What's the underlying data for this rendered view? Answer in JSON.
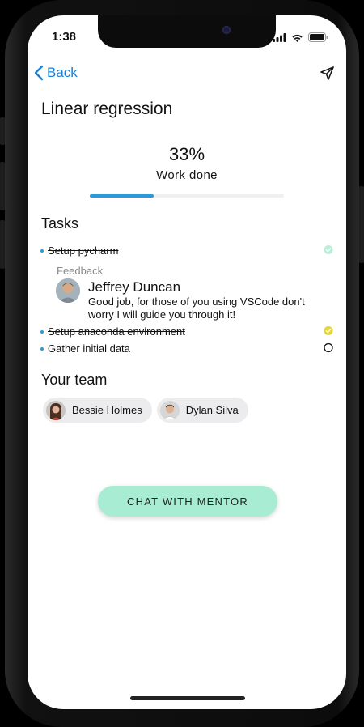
{
  "status_bar": {
    "time": "1:38"
  },
  "nav": {
    "back_label": "Back"
  },
  "page": {
    "title": "Linear regression"
  },
  "progress": {
    "percent_label": "33%",
    "label": "Work done",
    "fraction": 0.33
  },
  "tasks": {
    "heading": "Tasks",
    "items": [
      {
        "label": "Setup pycharm",
        "done": true,
        "status_color": "#b9eed8"
      },
      {
        "label": "Setup anaconda environment",
        "done": true,
        "status_color": "#e6d631"
      },
      {
        "label": "Gather initial data",
        "done": false,
        "status_color": "#ffffff"
      }
    ],
    "feedback": {
      "label": "Feedback",
      "author": "Jeffrey Duncan",
      "message": "Good job, for those of you using VSCode don't worry I will guide you through it!"
    }
  },
  "team": {
    "heading": "Your team",
    "members": [
      {
        "name": "Bessie Holmes"
      },
      {
        "name": "Dylan Silva"
      }
    ]
  },
  "cta": {
    "label": "CHAT WITH MENTOR"
  },
  "colors": {
    "accent": "#2a9bd8",
    "link": "#1a7fd6",
    "cta_bg": "#a9ecd4"
  }
}
